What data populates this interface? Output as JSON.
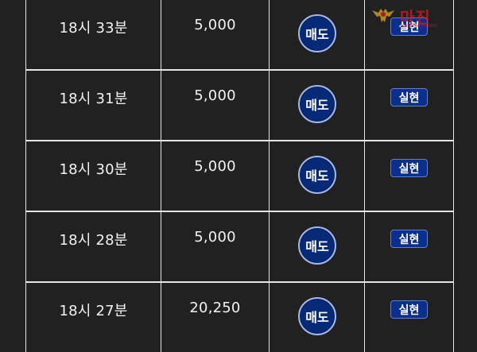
{
  "trades": [
    {
      "time": "18시 33분",
      "amount": "5,000",
      "action": "매도",
      "status": "실현"
    },
    {
      "time": "18시 31분",
      "amount": "5,000",
      "action": "매도",
      "status": "실현"
    },
    {
      "time": "18시 30분",
      "amount": "5,000",
      "action": "매도",
      "status": "실현"
    },
    {
      "time": "18시 28분",
      "amount": "5,000",
      "action": "매도",
      "status": "실현"
    },
    {
      "time": "18시 27분",
      "amount": "20,250",
      "action": "매도",
      "status": "실현"
    }
  ],
  "watermark": {
    "text": "마진",
    "sub": "www.majin.com"
  },
  "colors": {
    "background": "#212121",
    "grid_line": "#e6e6e6",
    "sell_button": "#062a78",
    "status_badge": "#0b2f8c",
    "watermark": "#c81e1e"
  }
}
